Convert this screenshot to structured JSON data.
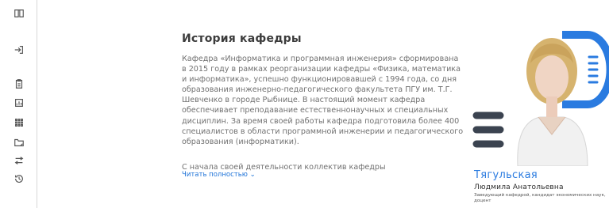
{
  "sidebar": {
    "icons": [
      "book-icon",
      "login-icon",
      "clipboard-icon",
      "chart-icon",
      "grid-icon",
      "folder-icon",
      "swap-icon",
      "history-icon"
    ]
  },
  "main": {
    "title": "История кафедры",
    "text": "Кафедра «Информатика и программная инженерия» сформирована в 2015 году в рамках реорганизации кафедры «Физика, математика и информатика», успешно функционировавшей с 1994 года, со дня образования инженерно-педагогического факультета ПГУ им. Т.Г. Шевченко в городе Рыбнице. В настоящий момент кафедра обеспечивает преподавание естественнонаучных и специальных дисциплин. За время своей работы кафедра подготовила более 400 специалистов в области программной инженерии и педагогического образования (информатики).",
    "text_continued": "С начала своей деятельности коллектив кафедры",
    "read_more": "Читать полностью ⌄"
  },
  "head": {
    "surname": "Тягульская",
    "first_patronymic": "Людмила Анатольевна",
    "position": "Заведующий кафедрой, кандидат экономических наук, доцент"
  },
  "colors": {
    "accent": "#2a7be0",
    "dark_stripes": "#3b4350"
  }
}
